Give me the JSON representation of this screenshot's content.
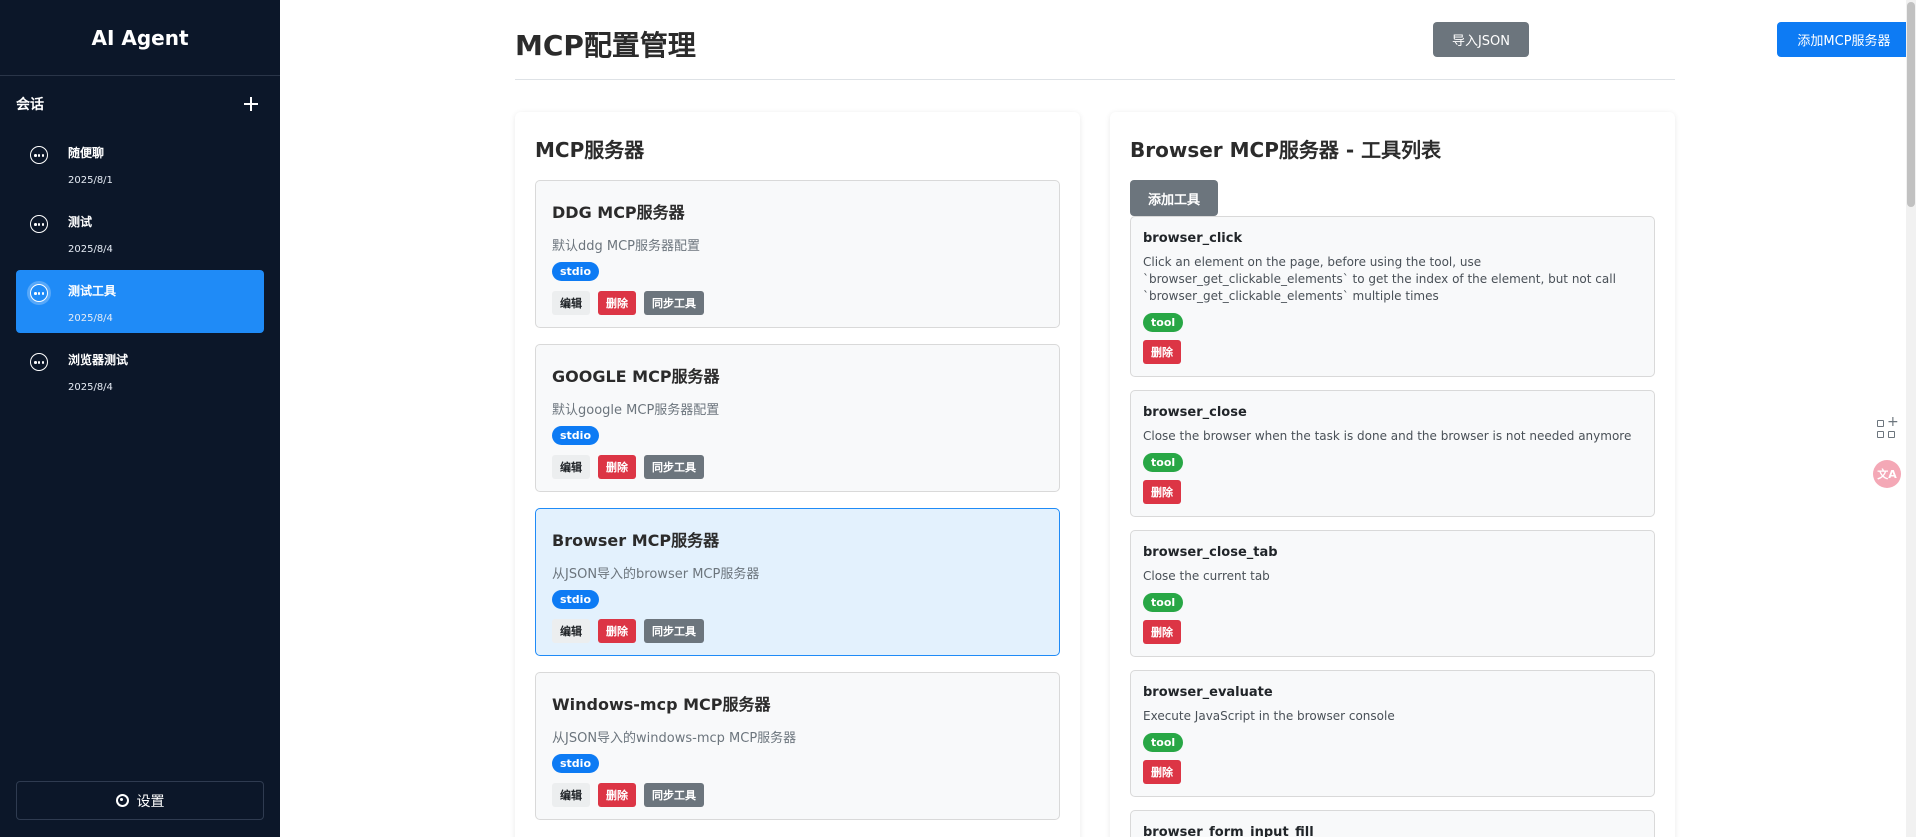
{
  "sidebar": {
    "app_title": "AI Agent",
    "sessions_label": "会话",
    "sessions": [
      {
        "title": "随便聊",
        "date": "2025/8/1",
        "active": false
      },
      {
        "title": "测试",
        "date": "2025/8/4",
        "active": false
      },
      {
        "title": "测试工具",
        "date": "2025/8/4",
        "active": true
      },
      {
        "title": "浏览器测试",
        "date": "2025/8/4",
        "active": false
      }
    ],
    "settings_label": "设置"
  },
  "header": {
    "title": "MCP配置管理",
    "import_label": "导入JSON",
    "add_server_label": "添加MCP服务器"
  },
  "servers_panel": {
    "title": "MCP服务器",
    "servers": [
      {
        "name": "DDG MCP服务器",
        "desc": "默认ddg MCP服务器配置",
        "type": "stdio",
        "active": false
      },
      {
        "name": "GOOGLE MCP服务器",
        "desc": "默认google MCP服务器配置",
        "type": "stdio",
        "active": false
      },
      {
        "name": "Browser MCP服务器",
        "desc": "从JSON导入的browser MCP服务器",
        "type": "stdio",
        "active": true
      },
      {
        "name": "Windows-mcp MCP服务器",
        "desc": "从JSON导入的windows-mcp MCP服务器",
        "type": "stdio",
        "active": false
      }
    ],
    "edit_label": "编辑",
    "delete_label": "删除",
    "sync_label": "同步工具"
  },
  "tools_panel": {
    "title": "Browser MCP服务器 - 工具列表",
    "add_tool_label": "添加工具",
    "tools": [
      {
        "name": "browser_click",
        "desc": "Click an element on the page, before using the tool, use `browser_get_clickable_elements` to get the index of the element, but not call `browser_get_clickable_elements` multiple times",
        "badge": "tool"
      },
      {
        "name": "browser_close",
        "desc": "Close the browser when the task is done and the browser is not needed anymore",
        "badge": "tool"
      },
      {
        "name": "browser_close_tab",
        "desc": "Close the current tab",
        "badge": "tool"
      },
      {
        "name": "browser_evaluate",
        "desc": "Execute JavaScript in the browser console",
        "badge": "tool"
      },
      {
        "name": "browser_form_input_fill",
        "desc": "",
        "badge": ""
      }
    ],
    "delete_label": "删除"
  },
  "floating": {
    "translate_label": "文A"
  },
  "colors": {
    "sidebar_bg": "#0c1729",
    "accent": "#1f8bf7",
    "primary_button": "#0d7bf4",
    "secondary_button": "#6c757d",
    "danger": "#dc3545",
    "success": "#28a745"
  }
}
